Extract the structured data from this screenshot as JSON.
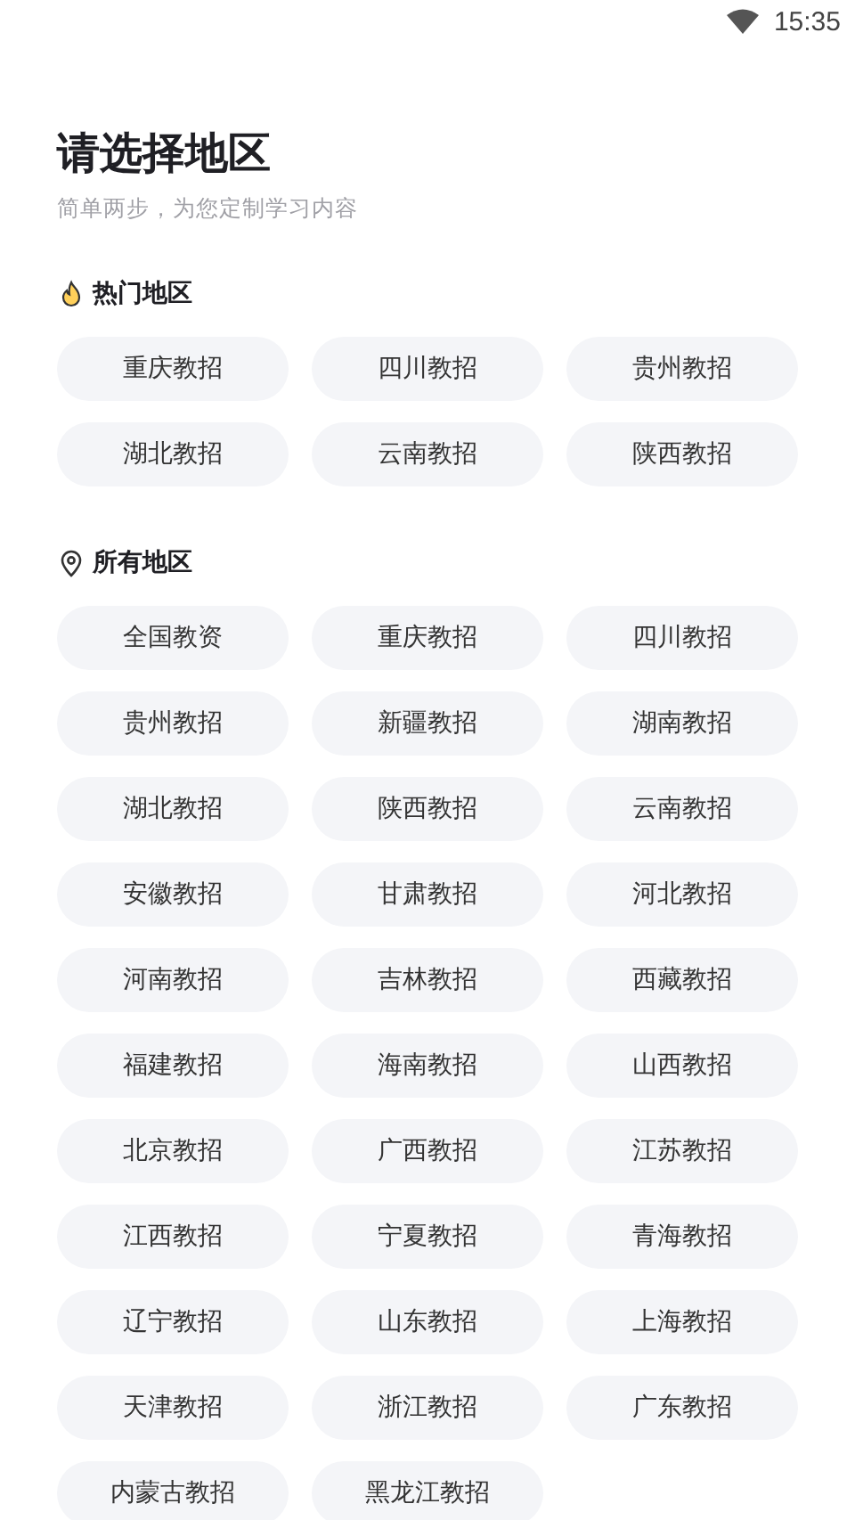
{
  "status_bar": {
    "time": "15:35"
  },
  "title": "请选择地区",
  "subtitle": "简单两步，为您定制学习内容",
  "sections": [
    {
      "kind": "hot",
      "heading": "热门地区",
      "regions": [
        "重庆教招",
        "四川教招",
        "贵州教招",
        "湖北教招",
        "云南教招",
        "陕西教招"
      ]
    },
    {
      "kind": "all",
      "heading": "所有地区",
      "regions": [
        "全国教资",
        "重庆教招",
        "四川教招",
        "贵州教招",
        "新疆教招",
        "湖南教招",
        "湖北教招",
        "陕西教招",
        "云南教招",
        "安徽教招",
        "甘肃教招",
        "河北教招",
        "河南教招",
        "吉林教招",
        "西藏教招",
        "福建教招",
        "海南教招",
        "山西教招",
        "北京教招",
        "广西教招",
        "江苏教招",
        "江西教招",
        "宁夏教招",
        "青海教招",
        "辽宁教招",
        "山东教招",
        "上海教招",
        "天津教招",
        "浙江教招",
        "广东教招",
        "内蒙古教招",
        "黑龙江教招"
      ]
    }
  ]
}
